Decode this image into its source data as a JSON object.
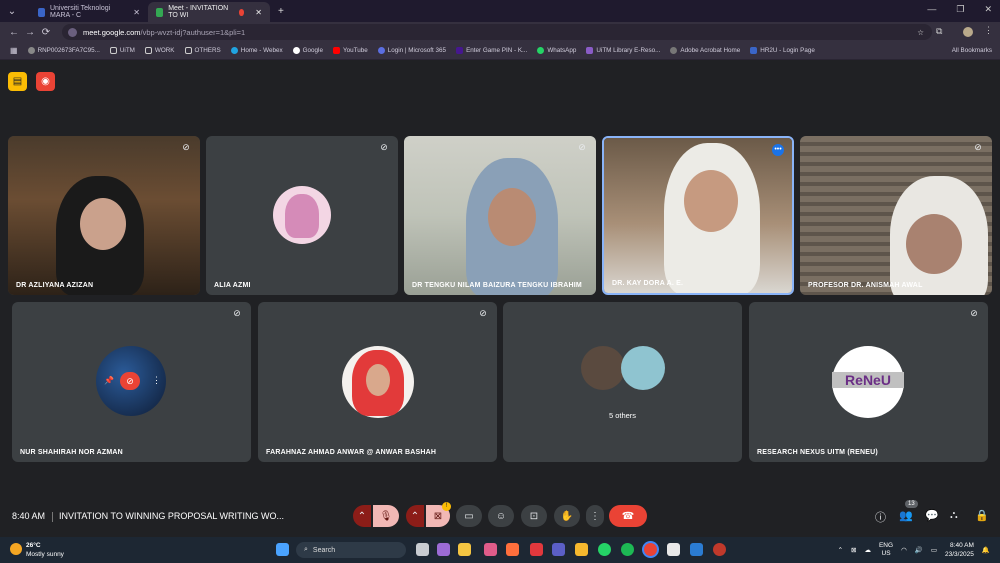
{
  "browser": {
    "tabs": [
      {
        "title": "Universiti Teknologi MARA - C",
        "active": false,
        "close": "✕"
      },
      {
        "title": "Meet - INVITATION TO WI",
        "active": true,
        "close": "✕"
      }
    ],
    "new_tab": "+",
    "url_host": "meet.google.com",
    "url_path": "/vbp-wvzt-idj?authuser=1&pli=1",
    "bookmarks": [
      "RNP002673FA7C95...",
      "UiTM",
      "WORK",
      "OTHERS",
      "Home - Webex",
      "Google",
      "YouTube",
      "Login | Microsoft 365",
      "Enter Game PIN - K...",
      "WhatsApp",
      "UiTM Library E-Reso...",
      "Adobe Acrobat Home",
      "HR2U - Login Page"
    ],
    "all_bookmarks": "All Bookmarks"
  },
  "meet": {
    "participants_top": [
      {
        "name": "DR AZLIYANA AZIZAN",
        "kind": "video"
      },
      {
        "name": "ALIA AZMI",
        "kind": "avatar"
      },
      {
        "name": "DR TENGKU NILAM BAIZURA TENGKU IBRAHIM",
        "kind": "video"
      },
      {
        "name": "DR. KAY DORA A. E.",
        "kind": "video"
      },
      {
        "name": "PROFESOR DR. ANISMAH AWAL",
        "kind": "video"
      }
    ],
    "participants_bottom": [
      {
        "name": "NUR SHAHIRAH NOR AZMAN",
        "kind": "avatar"
      },
      {
        "name": "FARAHNAZ AHMAD ANWAR @ ANWAR BASHAH",
        "kind": "avatar"
      },
      {
        "name": "",
        "kind": "others",
        "label": "5 others"
      },
      {
        "name": "RESEARCH NEXUS UITM (RENEU)",
        "kind": "avatar",
        "logo_text": "ReNeU"
      }
    ],
    "time": "8:40 AM",
    "meeting_title": "INVITATION TO WINNING PROPOSAL WRITING WO...",
    "people_count": "13"
  },
  "taskbar": {
    "weather_temp": "26°C",
    "weather_desc": "Mostly sunny",
    "search_placeholder": "Search",
    "lang_1": "ENG",
    "lang_2": "US",
    "clock_time": "8:40 AM",
    "clock_date": "23/3/2025"
  },
  "colors": {
    "meet_bg": "#202124",
    "tile_bg": "#3c4043",
    "active_border": "#8ab4f8",
    "end_call": "#ea4335"
  }
}
